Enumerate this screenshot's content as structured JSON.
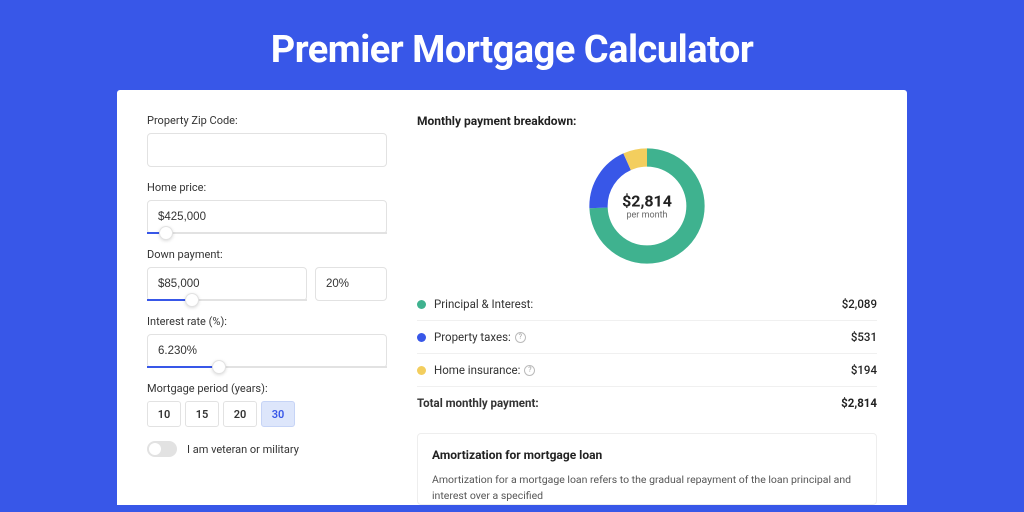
{
  "title": "Premier Mortgage Calculator",
  "form": {
    "zip_label": "Property Zip Code:",
    "zip_value": "",
    "home_price_label": "Home price:",
    "home_price_value": "$425,000",
    "down_payment_label": "Down payment:",
    "down_payment_value": "$85,000",
    "down_payment_pct": "20%",
    "interest_label": "Interest rate (%):",
    "interest_value": "6.230%",
    "period_label": "Mortgage period (years):",
    "period_options": [
      "10",
      "15",
      "20",
      "30"
    ],
    "period_selected": "30",
    "veteran_label": "I am veteran or military"
  },
  "breakdown": {
    "title": "Monthly payment breakdown:",
    "total_display": "$2,814",
    "total_sub": "per month",
    "rows": [
      {
        "label": "Principal & Interest:",
        "value": "$2,089",
        "color": "#3FB28F",
        "info": false
      },
      {
        "label": "Property taxes:",
        "value": "$531",
        "color": "#3857E8",
        "info": true
      },
      {
        "label": "Home insurance:",
        "value": "$194",
        "color": "#F3CE5E",
        "info": true
      }
    ],
    "total_row": {
      "label": "Total monthly payment:",
      "value": "$2,814"
    }
  },
  "amortization": {
    "title": "Amortization for mortgage loan",
    "body": "Amortization for a mortgage loan refers to the gradual repayment of the loan principal and interest over a specified"
  },
  "chart_data": {
    "type": "pie",
    "title": "Monthly payment breakdown",
    "series": [
      {
        "name": "Principal & Interest",
        "value": 2089,
        "color": "#3FB28F"
      },
      {
        "name": "Property taxes",
        "value": 531,
        "color": "#3857E8"
      },
      {
        "name": "Home insurance",
        "value": 194,
        "color": "#F3CE5E"
      }
    ],
    "total": 2814,
    "unit": "USD per month"
  }
}
